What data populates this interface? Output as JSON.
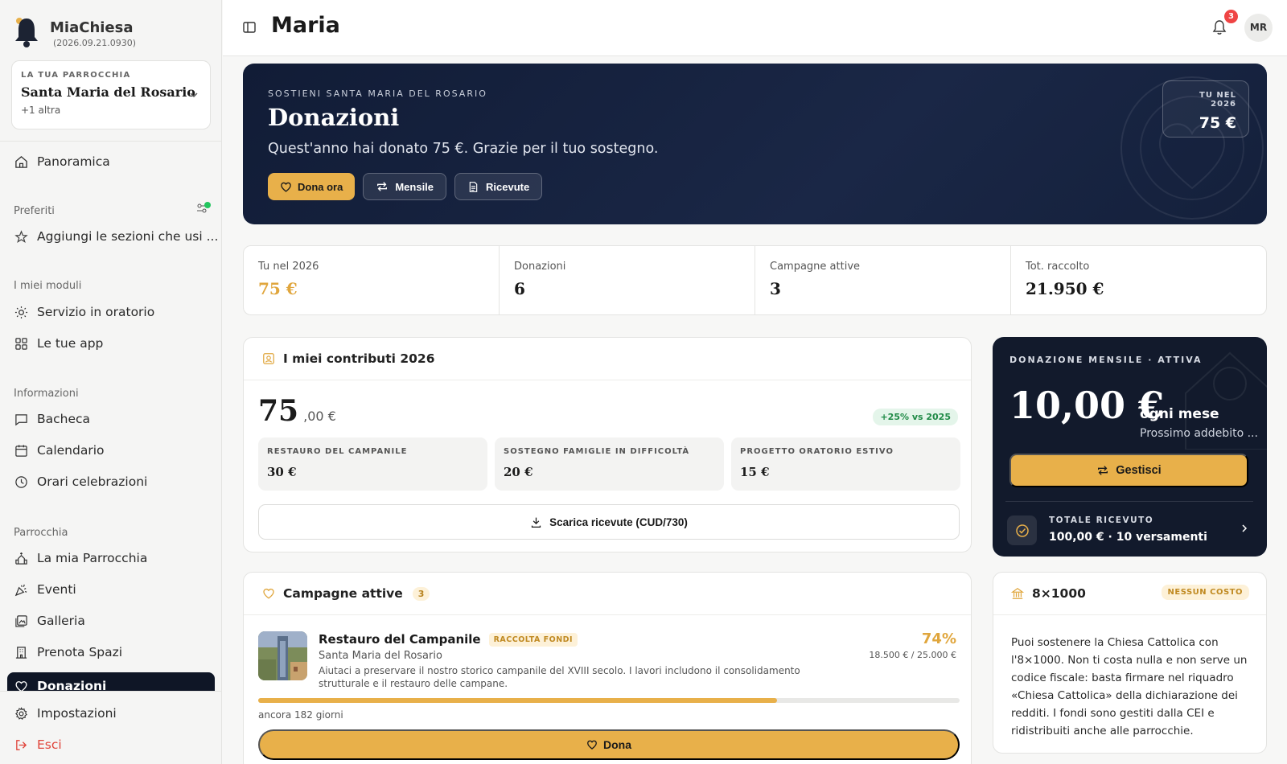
{
  "app": {
    "name": "MiaChiesa",
    "version": "(2026.09.21.0930)"
  },
  "parish_selector": {
    "kicker": "LA TUA PARROCCHIA",
    "name": "Santa Maria del Rosario",
    "more": "+1 altra"
  },
  "sidebar": {
    "overview": "Panoramica",
    "favorites_section": "Preferiti",
    "favorites_add": "Aggiungi le sezioni che usi ...",
    "modules_section": "I miei moduli",
    "modules": [
      "Servizio in oratorio",
      "Le tue app"
    ],
    "info_section": "Informazioni",
    "info": [
      "Bacheca",
      "Calendario",
      "Orari celebrazioni"
    ],
    "parish_section": "Parrocchia",
    "parish": [
      "La mia Parrocchia",
      "Eventi",
      "Galleria",
      "Prenota Spazi"
    ],
    "active": "Donazioni",
    "settings": "Impostazioni",
    "logout": "Esci"
  },
  "header": {
    "title": "Maria",
    "notifications": "3",
    "avatar": "MR"
  },
  "hero": {
    "kicker": "SOSTIENI SANTA MARIA DEL ROSARIO",
    "title": "Donazioni",
    "subtitle": "Quest'anno hai donato 75 €. Grazie per il tuo sostegno.",
    "btn_donate": "Dona ora",
    "btn_monthly": "Mensile",
    "btn_receipts": "Ricevute",
    "year_kicker": "TU NEL 2026",
    "year_value": "75 €"
  },
  "stats": [
    {
      "label": "Tu nel 2026",
      "value": "75 €"
    },
    {
      "label": "Donazioni",
      "value": "6"
    },
    {
      "label": "Campagne attive",
      "value": "3"
    },
    {
      "label": "Tot. raccolto",
      "value": "21.950 €"
    }
  ],
  "contributions": {
    "title": "I miei contributi 2026",
    "amount_int": "75",
    "amount_dec": ",00 €",
    "delta": "+25% vs 2025",
    "items": [
      {
        "label": "RESTAURO DEL CAMPANILE",
        "value": "30 €"
      },
      {
        "label": "SOSTEGNO FAMIGLIE IN DIFFICOLTÀ",
        "value": "20 €"
      },
      {
        "label": "PROGETTO ORATORIO ESTIVO",
        "value": "15 €"
      }
    ],
    "download": "Scarica ricevute (CUD/730)"
  },
  "monthly": {
    "kicker": "DONAZIONE MENSILE · ATTIVA",
    "amount": "10,00 €",
    "per": "ogni mese",
    "next": "Prossimo addebito ...",
    "manage": "Gestisci",
    "total_kicker": "TOTALE RICEVUTO",
    "total_value": "100,00 € · 10 versamenti"
  },
  "campaigns": {
    "title": "Campagne attive",
    "count": "3",
    "items": [
      {
        "title": "Restauro del Campanile",
        "tag": "RACCOLTA FONDI",
        "parish": "Santa Maria del Rosario",
        "description": "Aiutaci a preservare il nostro storico campanile del XVIII secolo. I lavori includono il consolidamento strutturale e il restauro delle campane.",
        "percent": "74%",
        "progress": 0.74,
        "amounts": "18.500 € / 25.000 €",
        "days_left": "ancora 182 giorni",
        "donate": "Dona"
      }
    ]
  },
  "otto": {
    "title": "8×1000",
    "tag": "NESSUN COSTO",
    "text": "Puoi sostenere la Chiesa Cattolica con l'8×1000. Non ti costa nulla e non serve un codice fiscale: basta firmare nel riquadro «Chiesa Cattolica» della dichiarazione dei redditi. I fondi sono gestiti dalla CEI e ridistribuiti anche alle parrocchie."
  },
  "colors": {
    "navy": "#121a2c",
    "gold": "#e8b04a",
    "green": "#1f8a46",
    "danger": "#e0443a"
  }
}
